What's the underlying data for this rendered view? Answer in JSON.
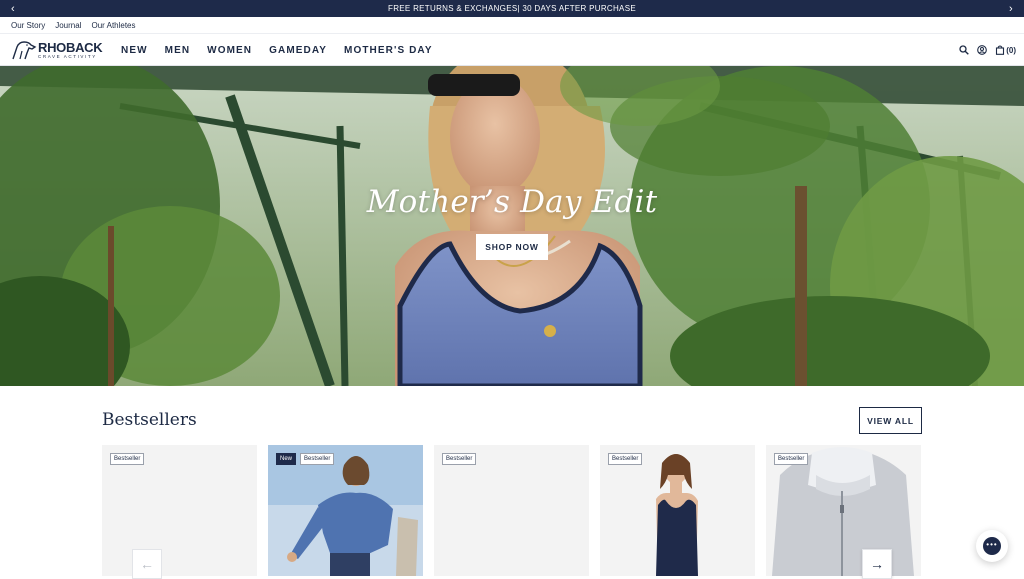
{
  "announcement": {
    "text": "FREE RETURNS & EXCHANGES| 30 DAYS AFTER PURCHASE",
    "prev_icon": "chevron-left-icon",
    "next_icon": "chevron-right-icon"
  },
  "utility_links": [
    "Our Story",
    "Journal",
    "Our Athletes"
  ],
  "logo": {
    "brand": "RHOBACK",
    "tagline": "CRAVE ACTIVITY"
  },
  "nav": {
    "items": [
      "NEW",
      "MEN",
      "WOMEN",
      "GAMEDAY",
      "MOTHER'S DAY"
    ],
    "icons": [
      "search-icon",
      "account-icon",
      "bag-icon"
    ],
    "cart_count": "(0)"
  },
  "hero": {
    "title": "Mother’s Day Edit",
    "cta": "SHOP NOW"
  },
  "bestsellers": {
    "title": "Bestsellers",
    "view_all": "VIEW ALL",
    "products": [
      {
        "badges": [
          "Bestseller"
        ]
      },
      {
        "badges": [
          "New",
          "Bestseller"
        ]
      },
      {
        "badges": [
          "Bestseller"
        ]
      },
      {
        "badges": [
          "Bestseller"
        ]
      },
      {
        "badges": [
          "Bestseller"
        ]
      }
    ],
    "prev_icon": "arrow-left-icon",
    "next_icon": "arrow-right-icon"
  },
  "chat": {
    "icon": "chat-bubble-icon",
    "dots": "•••"
  },
  "colors": {
    "navy": "#1e2a4a",
    "text": "#1d2a44",
    "card_bg": "#f3f3f3"
  }
}
